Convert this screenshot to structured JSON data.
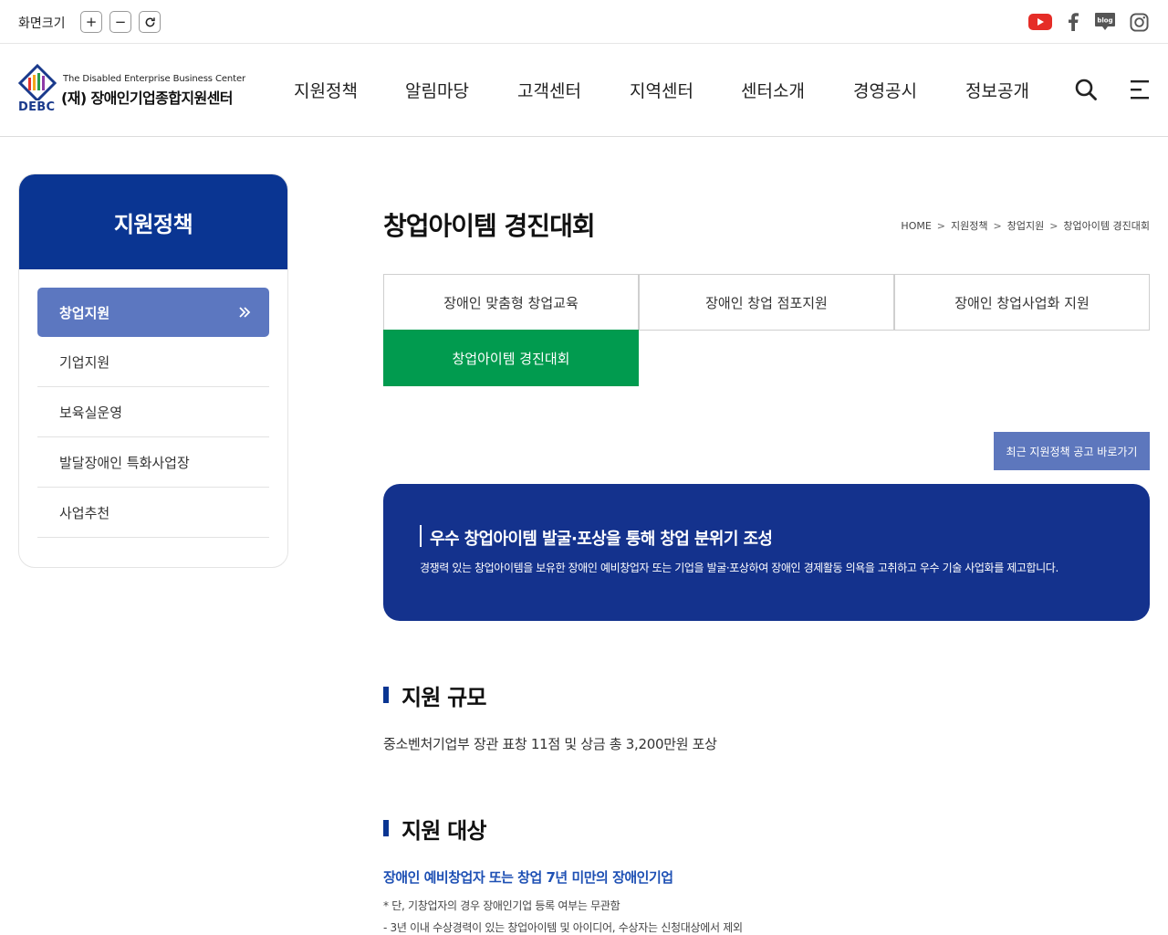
{
  "utility": {
    "zoom_label": "화면크기",
    "zoom_in": "+",
    "zoom_out": "−",
    "zoom_reset": "↻"
  },
  "social": {
    "youtube_color": "#e52d27",
    "blog_label": "blog"
  },
  "logo": {
    "english": "The Disabled Enterprise Business Center",
    "korean": "(재) 장애인기업종합지원센터",
    "abbr": "DEBC"
  },
  "gnb": [
    "지원정책",
    "알림마당",
    "고객센터",
    "지역센터",
    "센터소개",
    "경영공시",
    "정보공개"
  ],
  "sidebar": {
    "title": "지원정책",
    "active_item": "창업지원",
    "items": [
      "기업지원",
      "보육실운영",
      "발달장애인 특화사업장",
      "사업추천"
    ]
  },
  "page": {
    "title": "창업아이템 경진대회"
  },
  "breadcrumb": [
    "HOME",
    "지원정책",
    "창업지원",
    "창업아이템 경진대회"
  ],
  "breadcrumb_sep": ">",
  "tabs": [
    {
      "label": "장애인 맞춤형 창업교육",
      "active": false
    },
    {
      "label": "장애인 창업 점포지원",
      "active": false
    },
    {
      "label": "장애인 창업사업화 지원",
      "active": false
    },
    {
      "label": "창업아이템 경진대회",
      "active": true
    }
  ],
  "notice_button": "최근 지원정책 공고 바로가기",
  "banner": {
    "title": "우수 창업아이템 발굴·포상을 통해 창업 분위기 조성",
    "description": "경쟁력 있는 창업아이템을 보유한 장애인 예비창업자 또는 기업을 발굴·포상하여 장애인 경제활동 의욕을 고취하고 우수 기술 사업화를 제고합니다."
  },
  "sections": {
    "scale": {
      "title": "지원 규모",
      "text": "중소벤처기업부 장관 표창 11점 및 상금 총 3,200만원 포상"
    },
    "target": {
      "title": "지원 대상",
      "emphasis": "장애인 예비창업자 또는 창업 7년 미만의 장애인기업",
      "note1": "* 단, 기창업자의 경우 장애인기업 등록 여부는 무관함",
      "note2": "- 3년 이내 수상경력이 있는 창업아이템 및 아이디어, 수상자는 신청대상에서 제외"
    }
  },
  "colors": {
    "primary_navy": "#0a3592",
    "banner_navy": "#14328d",
    "active_green": "#019b4f",
    "side_active": "#5c77c0",
    "emphasis_blue": "#1e50b4"
  }
}
